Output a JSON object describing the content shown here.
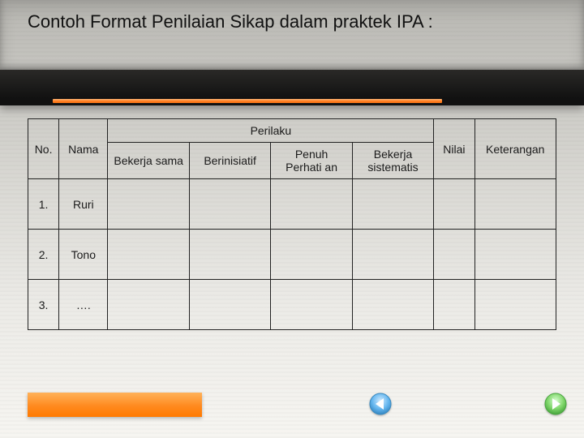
{
  "title": "Contoh Format Penilaian Sikap dalam praktek IPA :",
  "table": {
    "headers": {
      "no": "No.",
      "nama": "Nama",
      "perilaku": "Perilaku",
      "nilai": "Nilai",
      "keterangan": "Keterangan",
      "sub": {
        "c1": "Bekerja sama",
        "c2": "Berinisiatif",
        "c3": "Penuh Perhati an",
        "c4": "Bekerja sistematis"
      }
    },
    "rows": [
      {
        "no": "1.",
        "nama": "Ruri",
        "c1": "",
        "c2": "",
        "c3": "",
        "c4": "",
        "nilai": "",
        "ket": ""
      },
      {
        "no": "2.",
        "nama": "Tono",
        "c1": "",
        "c2": "",
        "c3": "",
        "c4": "",
        "nilai": "",
        "ket": ""
      },
      {
        "no": "3.",
        "nama": "….",
        "c1": "",
        "c2": "",
        "c3": "",
        "c4": "",
        "nilai": "",
        "ket": ""
      }
    ]
  },
  "chart_data": {
    "type": "table",
    "title": "Contoh Format Penilaian Sikap dalam praktek IPA",
    "columns": [
      "No.",
      "Nama",
      "Bekerja sama",
      "Berinisiatif",
      "Penuh Perhatian",
      "Bekerja sistematis",
      "Nilai",
      "Keterangan"
    ],
    "rows": [
      [
        "1.",
        "Ruri",
        "",
        "",
        "",
        "",
        "",
        ""
      ],
      [
        "2.",
        "Tono",
        "",
        "",
        "",
        "",
        "",
        ""
      ],
      [
        "3.",
        "….",
        "",
        "",
        "",
        "",
        "",
        ""
      ]
    ]
  }
}
